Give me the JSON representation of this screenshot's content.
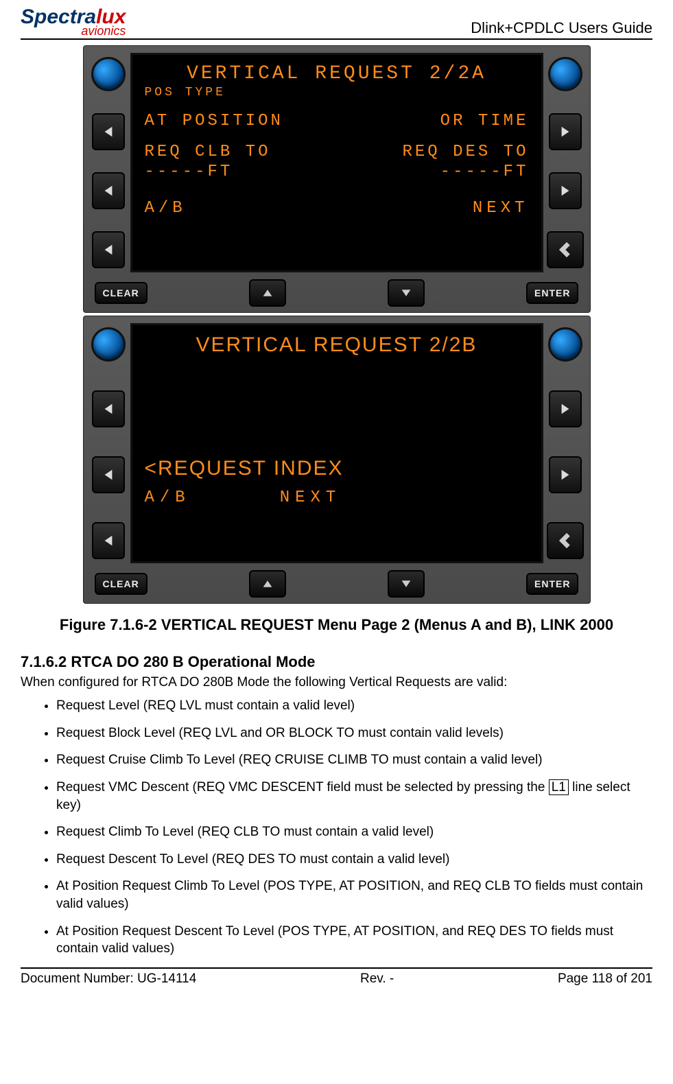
{
  "header": {
    "logo_main_a": "Spectra",
    "logo_main_b": "lux",
    "logo_sub": "avionics",
    "doc_title": "Dlink+CPDLC Users Guide"
  },
  "mcduA": {
    "title": "VERTICAL REQUEST 2/2A",
    "l1_small": "POS TYPE",
    "row1_left": "AT POSITION",
    "row1_right": "OR TIME",
    "row2_left": "REQ CLB TO",
    "row2_right": "REQ DES TO",
    "row2b_left": "-----FT",
    "row2b_right": "-----FT",
    "ab_left": "A/B",
    "ab_right": "NEXT",
    "clear": "CLEAR",
    "enter": "ENTER"
  },
  "mcduB": {
    "title": "VERTICAL REQUEST 2/2B",
    "req_index": "<REQUEST INDEX",
    "ab_left": "A/B",
    "ab_right": "NEXT",
    "clear": "CLEAR",
    "enter": "ENTER"
  },
  "figure_caption": "Figure 7.1.6-2 VERTICAL REQUEST Menu Page 2 (Menus A and B), LINK 2000",
  "section": {
    "heading": "7.1.6.2  RTCA DO 280 B Operational Mode",
    "intro": "When configured for RTCA DO 280B Mode the following Vertical Requests are valid:",
    "bullets": [
      "Request Level (REQ LVL must contain a valid level)",
      "Request Block Level (REQ LVL and OR BLOCK TO must contain valid levels)",
      "Request Cruise Climb To Level (REQ CRUISE CLIMB TO must contain a valid level)",
      "Request VMC Descent (REQ VMC DESCENT field must be selected by pressing the |L1| line select key)",
      "Request Climb To Level (REQ CLB TO must contain a valid level)",
      "Request Descent To Level (REQ DES TO must contain a valid level)",
      "At Position Request Climb To Level (POS TYPE, AT POSITION, and REQ CLB TO fields must contain valid values)",
      "At Position Request Descent To Level (POS TYPE, AT POSITION, and REQ DES TO fields must contain valid values)"
    ]
  },
  "footer": {
    "doc_number": "Document Number:  UG-14114",
    "rev": "Rev. -",
    "page": "Page 118 of 201"
  }
}
